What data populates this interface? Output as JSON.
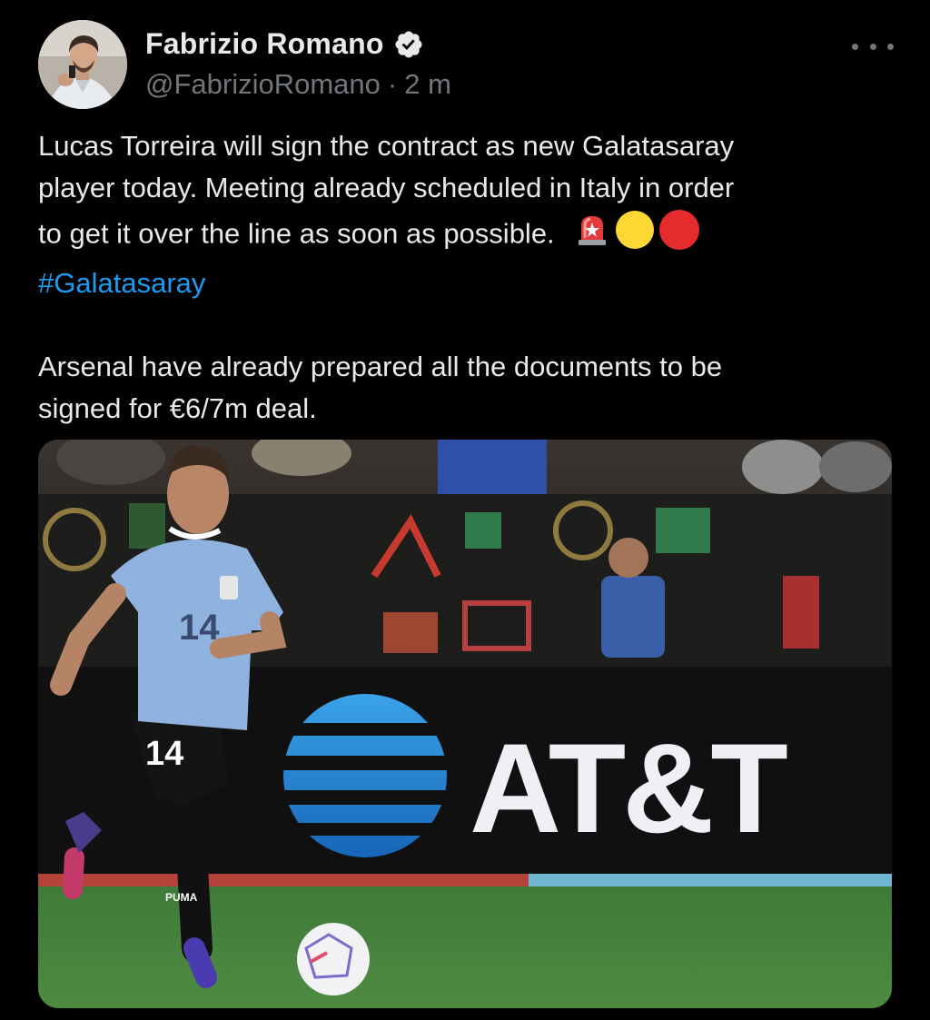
{
  "tweet": {
    "author": {
      "display_name": "Fabrizio Romano",
      "handle": "@FabrizioRomano",
      "verified": true
    },
    "separator": "·",
    "time_ago": "2 m",
    "text": {
      "line1": "Lucas Torreira will sign the contract as new Galatasaray",
      "line2": "player today. Meeting already scheduled in Italy in order",
      "line3": "to get it over the line as soon as possible.",
      "hashtag": "#Galatasaray",
      "line4": "Arsenal have already prepared all the documents to be",
      "line5": "signed for €6/7m deal."
    },
    "emojis": [
      "siren-emoji",
      "yellow-circle-emoji",
      "red-circle-emoji"
    ],
    "media": {
      "jersey_number": "14",
      "shorts_number": "14",
      "sponsor_board_text": "AT&T",
      "shorts_brand": "PUMA"
    }
  },
  "colors": {
    "background": "#000000",
    "text_primary": "#e7e9ea",
    "text_secondary": "#71767b",
    "link": "#1d9bf0",
    "verified_badge": "#e7e9ea"
  }
}
